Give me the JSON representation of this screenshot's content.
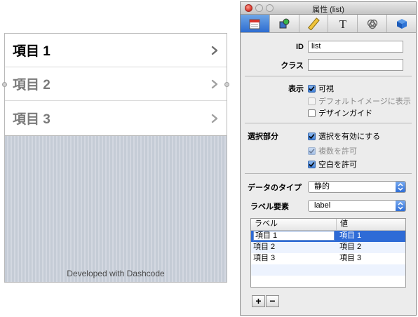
{
  "canvas": {
    "items": [
      {
        "label": "項目 1"
      },
      {
        "label": "項目 2"
      },
      {
        "label": "項目 3"
      }
    ],
    "footer": "Developed with Dashcode"
  },
  "inspector": {
    "title": "属性 (list)",
    "tabs": [
      "attributes-icon",
      "fill-stroke-icon",
      "metrics-icon",
      "text-icon",
      "behaviors-icon",
      "3d-box-icon"
    ],
    "id_label": "ID",
    "id_value": "list",
    "class_label": "クラス",
    "class_value": "",
    "display_label": "表示",
    "visible_label": "可視",
    "visible_checked": true,
    "default_image_label": "デフォルトイメージに表示",
    "default_image_checked": false,
    "design_guide_label": "デザインガイド",
    "design_guide_checked": false,
    "selection_label": "選択部分",
    "enable_selection_label": "選択を有効にする",
    "enable_selection_checked": true,
    "allow_multiple_label": "複数を許可",
    "allow_multiple_checked": true,
    "allow_empty_label": "空白を許可",
    "allow_empty_checked": true,
    "data_type_label": "データのタイプ",
    "data_type_value": "静的",
    "label_element_label": "ラベル要素",
    "label_element_value": "label",
    "table": {
      "headers": [
        "ラベル",
        "値"
      ],
      "rows": [
        {
          "label": "項目 1",
          "value": "項目 1"
        },
        {
          "label": "項目 2",
          "value": "項目 2"
        },
        {
          "label": "項目 3",
          "value": "項目 3"
        }
      ]
    },
    "add_button": "+",
    "remove_button": "−"
  }
}
